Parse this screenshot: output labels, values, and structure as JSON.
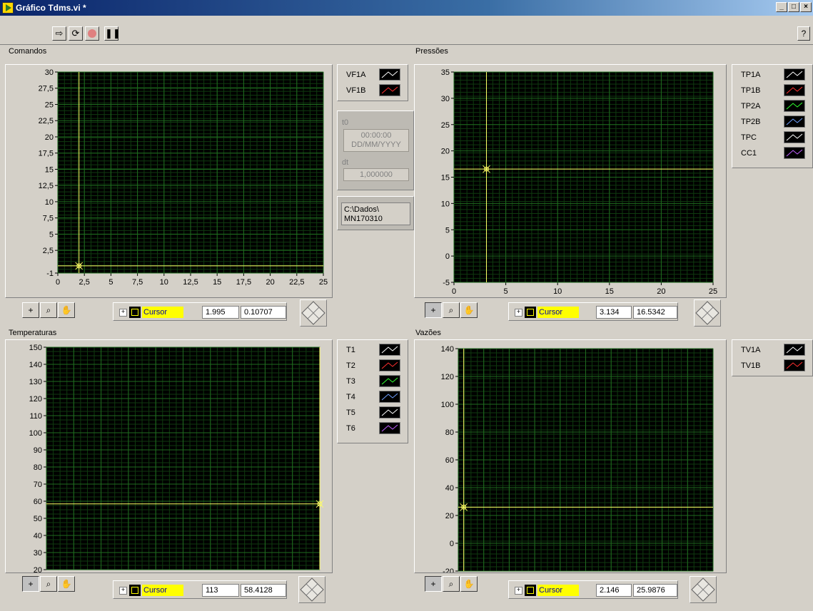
{
  "window": {
    "title": "Gráfico Tdms.vi *"
  },
  "toolbar": {
    "run_icon": "run-arrow-icon",
    "run_continuous_icon": "run-continuous-icon",
    "abort_icon": "abort-icon",
    "pause_icon": "pause-icon",
    "help_icon": "help-icon"
  },
  "colors": {
    "plot_bg": "#000000",
    "grid": "#1f6b1f",
    "minor_grid": "#0f3a0f",
    "cursor": "#ffff66",
    "panel": "#d4d0c8"
  },
  "info": {
    "t0_label": "t0",
    "t0_time": "00:00:00",
    "t0_date": "DD/MM/YYYY",
    "dt_label": "dt",
    "dt_value": "1,000000",
    "path_line1": "C:\\Dados\\",
    "path_line2": "MN170310"
  },
  "graphs": {
    "comandos": {
      "label": "Comandos",
      "legend": [
        {
          "name": "VF1A",
          "color": "#ffffff"
        },
        {
          "name": "VF1B",
          "color": "#ff3030"
        }
      ],
      "cursor": {
        "name": "Cursor",
        "x": "1.995",
        "y": "0.10707"
      }
    },
    "pressoes": {
      "label": "Pressões",
      "legend": [
        {
          "name": "TP1A",
          "color": "#ffffff"
        },
        {
          "name": "TP1B",
          "color": "#ff3030"
        },
        {
          "name": "TP2A",
          "color": "#30ff30"
        },
        {
          "name": "TP2B",
          "color": "#6fa0ff"
        },
        {
          "name": "TPC",
          "color": "#ffffff"
        },
        {
          "name": "CC1",
          "color": "#c060ff"
        }
      ],
      "cursor": {
        "name": "Cursor",
        "x": "3.134",
        "y": "16.5342"
      }
    },
    "temperaturas": {
      "label": "Temperaturas",
      "legend": [
        {
          "name": "T1",
          "color": "#ffffff"
        },
        {
          "name": "T2",
          "color": "#ff3030"
        },
        {
          "name": "T3",
          "color": "#30ff30"
        },
        {
          "name": "T4",
          "color": "#6fa0ff"
        },
        {
          "name": "T5",
          "color": "#ffffff"
        },
        {
          "name": "T6",
          "color": "#c060ff"
        }
      ],
      "cursor": {
        "name": "Cursor",
        "x": "113",
        "y": "58.4128"
      }
    },
    "vazoes": {
      "label": "Vazões",
      "legend": [
        {
          "name": "TV1A",
          "color": "#ffffff"
        },
        {
          "name": "TV1B",
          "color": "#ff3030"
        }
      ],
      "cursor": {
        "name": "Cursor",
        "x": "2.146",
        "y": "25.9876"
      }
    }
  },
  "chart_data": [
    {
      "type": "line",
      "title": "Comandos",
      "xlim": [
        0,
        25
      ],
      "ylim": [
        -1,
        30
      ],
      "x_ticks": [
        "0",
        "2,5",
        "5",
        "7,5",
        "10",
        "12,5",
        "15",
        "17,5",
        "20",
        "22,5",
        "25"
      ],
      "x_tick_values": [
        0,
        2.5,
        5,
        7.5,
        10,
        12.5,
        15,
        17.5,
        20,
        22.5,
        25
      ],
      "y_ticks": [
        "30",
        "27,5",
        "25",
        "22,5",
        "20",
        "17,5",
        "15",
        "12,5",
        "10",
        "7,5",
        "5",
        "2,5",
        "-1"
      ],
      "y_tick_values": [
        30,
        27.5,
        25,
        22.5,
        20,
        17.5,
        15,
        12.5,
        10,
        7.5,
        5,
        2.5,
        -1
      ],
      "series": [
        {
          "name": "VF1A",
          "values": []
        },
        {
          "name": "VF1B",
          "values": []
        }
      ],
      "cursor": {
        "x": 1.995,
        "y": 0.10707
      },
      "grid": true
    },
    {
      "type": "line",
      "title": "Pressões",
      "xlim": [
        0,
        25
      ],
      "ylim": [
        -5,
        35
      ],
      "x_ticks": [
        "0",
        "5",
        "10",
        "15",
        "20",
        "25"
      ],
      "x_tick_values": [
        0,
        5,
        10,
        15,
        20,
        25
      ],
      "y_ticks": [
        "35",
        "30",
        "25",
        "20",
        "15",
        "10",
        "5",
        "0",
        "-5"
      ],
      "y_tick_values": [
        35,
        30,
        25,
        20,
        15,
        10,
        5,
        0,
        -5
      ],
      "series": [
        {
          "name": "TP1A",
          "values": []
        },
        {
          "name": "TP1B",
          "values": []
        },
        {
          "name": "TP2A",
          "values": []
        },
        {
          "name": "TP2B",
          "values": []
        },
        {
          "name": "TPC",
          "values": []
        },
        {
          "name": "CC1",
          "values": []
        }
      ],
      "cursor": {
        "x": 3.134,
        "y": 16.5342
      },
      "grid": true
    },
    {
      "type": "line",
      "title": "Temperaturas",
      "xlim": [
        0,
        100
      ],
      "ylim": [
        20,
        150
      ],
      "x_ticks": [],
      "x_tick_values": [],
      "y_ticks": [
        "150",
        "140",
        "130",
        "120",
        "110",
        "100",
        "90",
        "80",
        "70",
        "60",
        "50",
        "40",
        "30",
        "20"
      ],
      "y_tick_values": [
        150,
        140,
        130,
        120,
        110,
        100,
        90,
        80,
        70,
        60,
        50,
        40,
        30,
        20
      ],
      "series": [
        {
          "name": "T1",
          "values": []
        },
        {
          "name": "T2",
          "values": []
        },
        {
          "name": "T3",
          "values": []
        },
        {
          "name": "T4",
          "values": []
        },
        {
          "name": "T5",
          "values": []
        },
        {
          "name": "T6",
          "values": []
        }
      ],
      "cursor": {
        "x": 113,
        "y": 58.4128
      },
      "grid": true
    },
    {
      "type": "line",
      "title": "Vazões",
      "xlim": [
        0,
        100
      ],
      "ylim": [
        -20,
        140
      ],
      "x_ticks": [],
      "x_tick_values": [],
      "y_ticks": [
        "140",
        "120",
        "100",
        "80",
        "60",
        "40",
        "20",
        "0",
        "-20"
      ],
      "y_tick_values": [
        140,
        120,
        100,
        80,
        60,
        40,
        20,
        0,
        -20
      ],
      "series": [
        {
          "name": "TV1A",
          "values": []
        },
        {
          "name": "TV1B",
          "values": []
        }
      ],
      "cursor": {
        "x": 2.146,
        "y": 25.9876
      },
      "grid": true
    }
  ]
}
